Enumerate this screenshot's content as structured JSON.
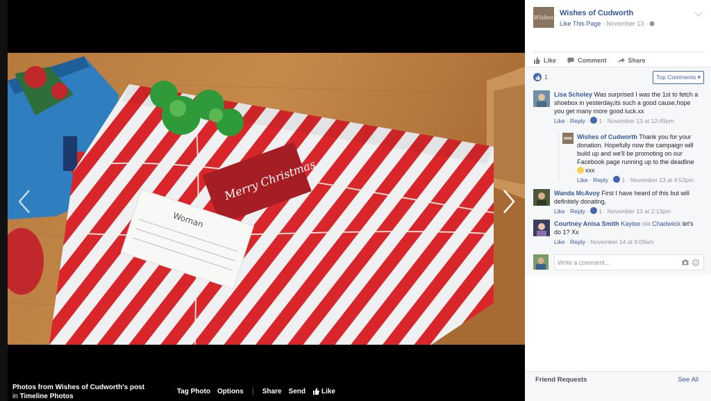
{
  "photo_viewer": {
    "caption_prefix": "Photos from Wishes of Cudworth's post",
    "caption_in": "in",
    "caption_album": "Timeline Photos",
    "actions": [
      "Tag Photo",
      "Options",
      "Share",
      "Send",
      "Like"
    ],
    "tag_card": "Woman",
    "gift_tag_text": "Merry Christmas"
  },
  "post": {
    "page_logo_text": "Wishes",
    "page_name": "Wishes of Cudworth",
    "like_page": "Like This Page",
    "date": "· November 13 ·",
    "actions": [
      "Like",
      "Comment",
      "Share"
    ],
    "like_count": "1",
    "sort_label": "Top Comments"
  },
  "comments": [
    {
      "author": "Lisa Scholey",
      "text": "Was surprised I was the 1st to fetch a shoebox in yesterday,its such a good cause,hope you get many more good luck.xx",
      "like": "Like",
      "reply": "Reply",
      "likes": "1",
      "time": "November 13 at 12:49pm",
      "reply_item": {
        "author": "Wishes of Cudworth",
        "text": "Thank you for your donation. Hopefully now the campaign will build up and we'll be promoting on our Facebook page running up to the deadline",
        "emoji_text": "xxx",
        "like": "Like",
        "reply": "Reply",
        "likes": "1",
        "time": "November 13 at 4:53pm"
      }
    },
    {
      "author": "Wanda McAvoy",
      "text": "First I have heard of this but will definitely donating,",
      "like": "Like",
      "reply": "Reply",
      "likes": "1",
      "time": "November 13 at 2:13pm"
    },
    {
      "author": "Courtney Anisa Smith",
      "mention": "Kaytee",
      "mention_sep": "ola",
      "mention2": "Chadwiick",
      "text": "let's do 1? Xx",
      "like": "Like",
      "reply": "Reply",
      "time": "November 14 at 9:09am"
    }
  ],
  "composer": {
    "placeholder": "Write a comment..."
  },
  "friend_requests": {
    "title": "Friend Requests",
    "see_all": "See All"
  },
  "colors": {
    "link": "#365899",
    "brand": "#4267b2"
  }
}
